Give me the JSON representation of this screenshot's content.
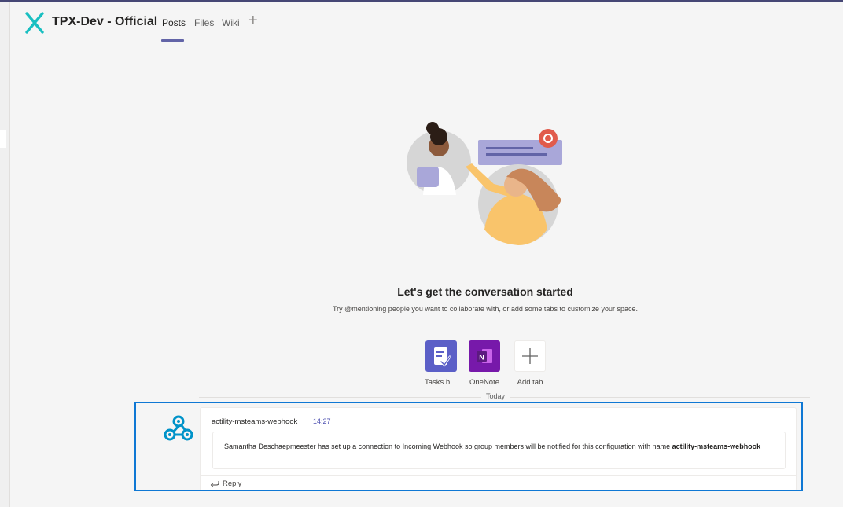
{
  "colors": {
    "accent": "#6264a7",
    "highlight_border": "#0f78d4",
    "timestamp": "#4f52b2",
    "planner": "#5b5fc7",
    "onenote": "#7719aa",
    "logo": "#19bfc1"
  },
  "header": {
    "logo_icon": "tpx-x-logo-icon",
    "team_name": "TPX-Dev - Official",
    "tabs": [
      {
        "label": "Posts",
        "active": true
      },
      {
        "label": "Files",
        "active": false
      },
      {
        "label": "Wiki",
        "active": false
      }
    ],
    "add_tab_icon": "plus-icon"
  },
  "hero": {
    "title": "Let's get the conversation started",
    "subtitle": "Try @mentioning people you want to collaborate with, or add some tabs to customize your space."
  },
  "apps": [
    {
      "label": "Tasks b...",
      "icon": "tasks-icon"
    },
    {
      "label": "OneNote",
      "icon": "onenote-icon"
    },
    {
      "label": "Add tab",
      "icon": "plus-icon"
    }
  ],
  "divider": {
    "label": "Today"
  },
  "message": {
    "avatar_icon": "webhook-icon",
    "author": "actility-msteams-webhook",
    "time": "14:27",
    "text": "Samantha Deschaepmeester has set up a connection to Incoming Webhook so group members will be notified for this configuration with name ",
    "bold_name": "actility-msteams-webhook",
    "reply_label": "Reply"
  }
}
